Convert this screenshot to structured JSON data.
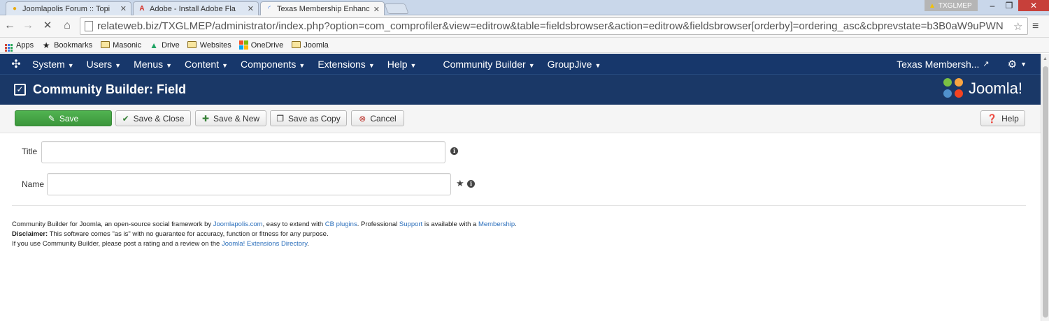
{
  "browser": {
    "tabs": [
      {
        "label": "Joomlapolis Forum :: Topi",
        "icon": "joomlapolis-icon"
      },
      {
        "label": "Adobe - Install Adobe Fla",
        "icon": "adobe-icon"
      },
      {
        "label": "Texas Membership Enhanc",
        "icon": "loading-icon"
      }
    ],
    "profile_name": "TXGLMEP",
    "url": "relateweb.biz/TXGLMEP/administrator/index.php?option=com_comprofiler&view=editrow&table=fieldsbrowser&action=editrow&fieldsbrowser[orderby]=ordering_asc&cbprevstate=b3B0aW9uPWN",
    "bookmarks": [
      {
        "label": "Apps",
        "icon": "apps-icon"
      },
      {
        "label": "Bookmarks",
        "icon": "star-icon"
      },
      {
        "label": "Masonic",
        "icon": "folder-icon"
      },
      {
        "label": "Drive",
        "icon": "drive-icon"
      },
      {
        "label": "Websites",
        "icon": "folder-icon"
      },
      {
        "label": "OneDrive",
        "icon": "windows-icon"
      },
      {
        "label": "Joomla",
        "icon": "folder-icon"
      }
    ]
  },
  "joomla": {
    "menu": [
      "System",
      "Users",
      "Menus",
      "Content",
      "Components",
      "Extensions",
      "Help",
      "Community Builder",
      "GroupJive"
    ],
    "site_name": "Texas Membersh...",
    "page_title": "Community Builder: Field",
    "brand": "Joomla!",
    "toolbar": {
      "save": "Save",
      "save_close": "Save & Close",
      "save_new": "Save & New",
      "save_copy": "Save as Copy",
      "cancel": "Cancel",
      "help": "Help"
    },
    "form": {
      "title_label": "Title",
      "title_value": "",
      "name_label": "Name",
      "name_value": ""
    },
    "footer": {
      "line1_pre": "Community Builder for Joomla, an open-source social framework by ",
      "line1_link1": "Joomlapolis.com",
      "line1_mid1": ", easy to extend with ",
      "line1_link2": "CB plugins",
      "line1_mid2": ". Professional ",
      "line1_link3": "Support",
      "line1_mid3": " is available with a ",
      "line1_link4": "Membership",
      "line1_end": ".",
      "disclaimer_label": "Disclaimer:",
      "disclaimer_text": " This software comes \"as is\" with no guarantee for accuracy, function or fitness for any purpose.",
      "line3_pre": "If you use Community Builder, please post a rating and a review on the ",
      "line3_link": "Joomla! Extensions Directory",
      "line3_end": "."
    }
  },
  "colors": {
    "nav_bg": "#17376b",
    "header_bg": "#1a3867",
    "save_green": "#46a546",
    "cancel_red": "#bd362f",
    "link_blue": "#2a6ebb"
  }
}
